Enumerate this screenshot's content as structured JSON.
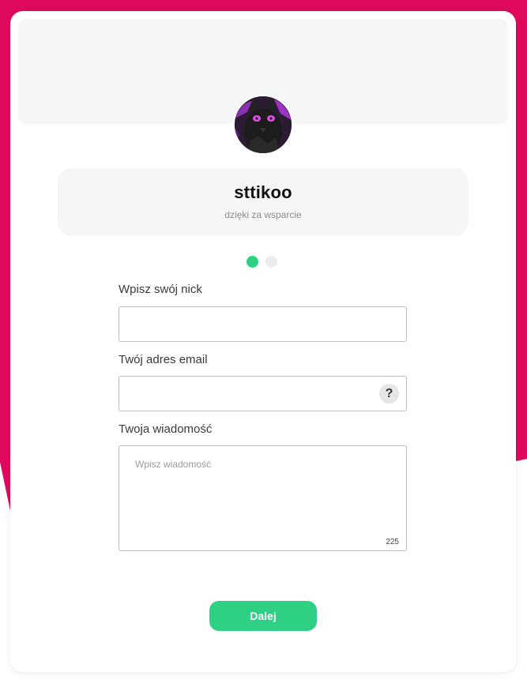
{
  "profile": {
    "name": "sttikoo",
    "subtitle": "dzięki za wsparcie",
    "avatar_icon": "avatar-character-icon"
  },
  "steps": {
    "total": 2,
    "current": 1
  },
  "form": {
    "nick_label": "Wpisz swój nick",
    "nick_value": "",
    "email_label": "Twój adres email",
    "email_value": "",
    "email_help": "?",
    "message_label": "Twoja wiadomość",
    "message_placeholder": "Wpisz wiadomość",
    "message_value": "",
    "char_counter": "225"
  },
  "actions": {
    "next_label": "Dalej"
  },
  "colors": {
    "accent": "#2ed184",
    "brand_background": "#df0a5b",
    "panel": "#f6f6f6"
  }
}
